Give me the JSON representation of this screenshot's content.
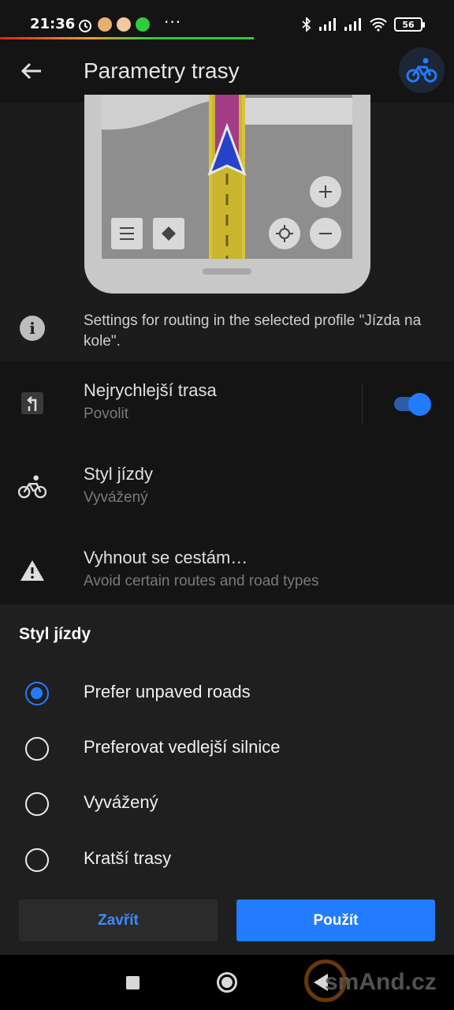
{
  "status_bar": {
    "time": "21:36",
    "more": "···",
    "battery": "56"
  },
  "app_bar": {
    "title": "Parametry trasy",
    "profile_icon": "bicycle-icon"
  },
  "info": {
    "text": "Settings for routing in the selected profile \"Jízda na kole\"."
  },
  "settings": [
    {
      "title": "Nejrychlejší trasa",
      "subtitle": "Povolit",
      "icon": "fastest-route-icon",
      "toggle_on": true
    },
    {
      "title": "Styl jízdy",
      "subtitle": "Vyvážený",
      "icon": "bicycle-icon"
    },
    {
      "title": "Vyhnout se cestám…",
      "subtitle": "Avoid certain routes and road types",
      "icon": "warning-icon"
    }
  ],
  "sheet": {
    "title": "Styl jízdy",
    "options": [
      {
        "label": "Prefer unpaved roads",
        "selected": true
      },
      {
        "label": "Preferovat vedlejší silnice",
        "selected": false
      },
      {
        "label": "Vyvážený",
        "selected": false
      },
      {
        "label": "Kratší trasy",
        "selected": false
      }
    ],
    "close_label": "Zavřít",
    "apply_label": "Použít"
  },
  "watermark": "smAnd.cz",
  "colors": {
    "accent": "#237bff",
    "background": "#141414",
    "sheet": "#1f1f1f"
  }
}
